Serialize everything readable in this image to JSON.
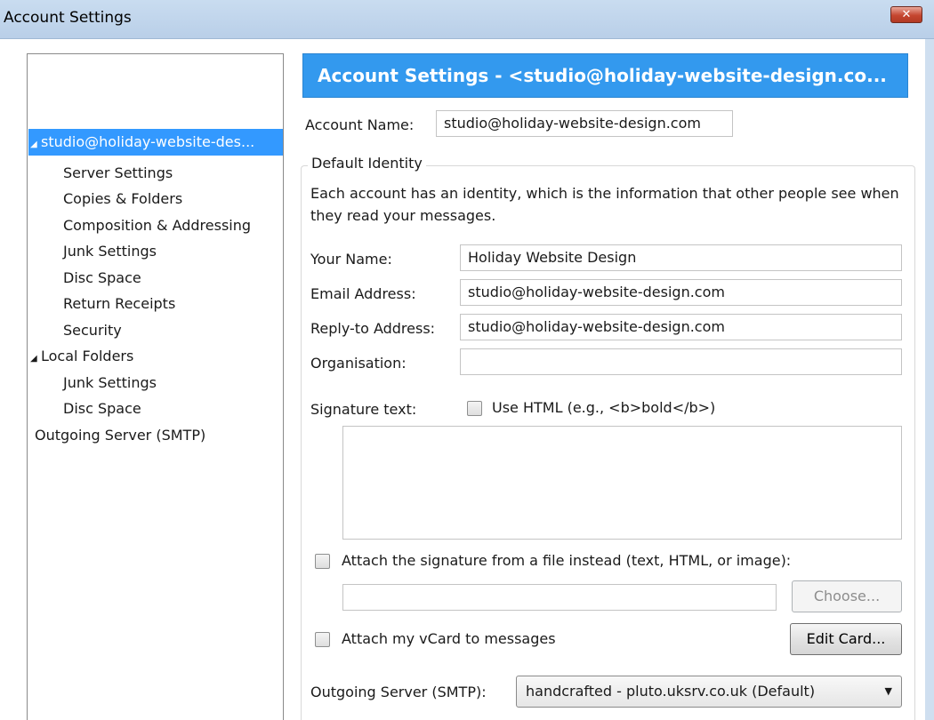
{
  "window": {
    "title": "Account Settings",
    "close_label": "✕"
  },
  "sidebar": {
    "items": [
      {
        "label": "studio@holiday-website-des...",
        "twisty": "◢"
      },
      {
        "label": "Server Settings"
      },
      {
        "label": "Copies & Folders"
      },
      {
        "label": "Composition & Addressing"
      },
      {
        "label": "Junk Settings"
      },
      {
        "label": "Disc Space"
      },
      {
        "label": "Return Receipts"
      },
      {
        "label": "Security"
      },
      {
        "label": "Local Folders",
        "twisty": "◢"
      },
      {
        "label": "Junk Settings"
      },
      {
        "label": "Disc Space"
      },
      {
        "label": "Outgoing Server (SMTP)"
      }
    ]
  },
  "main": {
    "header": "Account Settings - <studio@holiday-website-design.co...",
    "account_name_label": "Account Name:",
    "account_name_value": "studio@holiday-website-design.com",
    "identity_caption": "Default Identity",
    "identity_description": "Each account has an identity, which is the information that other people see when they read your messages.",
    "your_name_label": "Your Name:",
    "your_name_value": "Holiday Website Design",
    "email_label": "Email Address:",
    "email_value": "studio@holiday-website-design.com",
    "reply_to_label": "Reply-to Address:",
    "reply_to_value": "studio@holiday-website-design.com",
    "organisation_label": "Organisation:",
    "organisation_value": "",
    "signature_label": "Signature text:",
    "use_html_label": "Use HTML (e.g., <b>bold</b>)",
    "attach_signature_label": "Attach the signature from a file instead (text, HTML, or image):",
    "signature_file_value": "",
    "choose_button": "Choose...",
    "attach_vcard_label": "Attach my vCard to messages",
    "edit_card_button": "Edit Card...",
    "outgoing_server_label": "Outgoing Server (SMTP):",
    "outgoing_server_value": "handcrafted - pluto.uksrv.co.uk (Default)"
  }
}
